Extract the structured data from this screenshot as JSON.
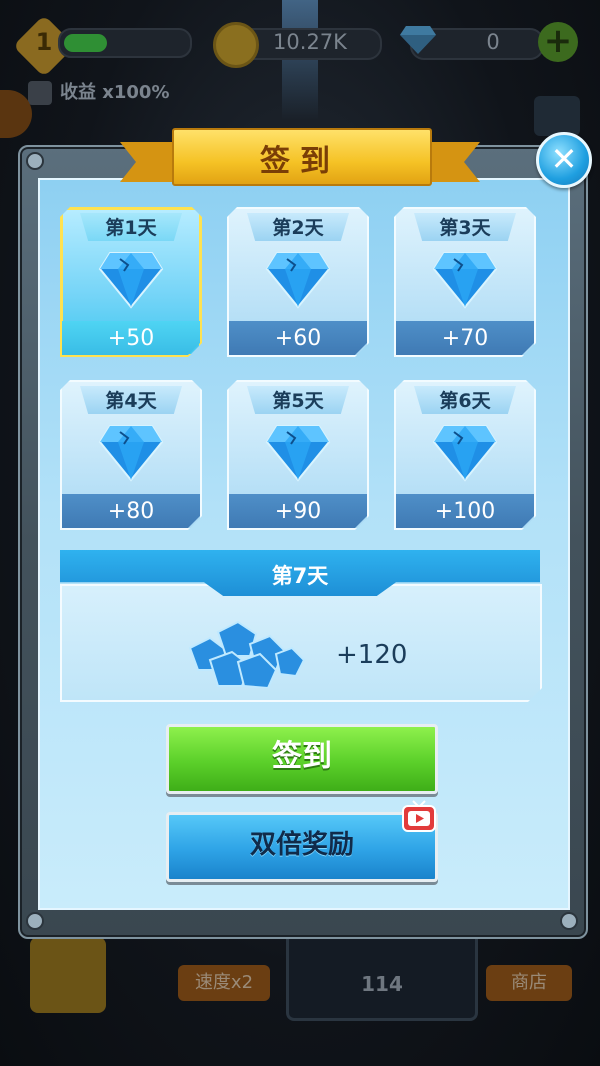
{
  "hud": {
    "level": "1",
    "level_progress": 0.35,
    "coins": "10.27K",
    "gems": "0",
    "plus_label": "+",
    "income": "收益 x100%"
  },
  "bottom_bar": {
    "speed_label": "速度x2",
    "slot_value": "114",
    "shop_label": "商店"
  },
  "modal": {
    "title": "签到",
    "close_label": "✕",
    "days": [
      {
        "label": "第1天",
        "reward": "+50",
        "active": true
      },
      {
        "label": "第2天",
        "reward": "+60",
        "active": false
      },
      {
        "label": "第3天",
        "reward": "+70",
        "active": false
      },
      {
        "label": "第4天",
        "reward": "+80",
        "active": false
      },
      {
        "label": "第5天",
        "reward": "+90",
        "active": false
      },
      {
        "label": "第6天",
        "reward": "+100",
        "active": false
      }
    ],
    "day7": {
      "label": "第7天",
      "reward": "+120"
    },
    "sign_button": "签到",
    "double_button": "双倍奖励"
  },
  "colors": {
    "active_border": "#ffe250",
    "sign_button": "#5bd02a",
    "double_button": "#2ea3e6",
    "title_ribbon": "#f5c225"
  },
  "icons": [
    "level-badge-icon",
    "coin-icon",
    "diamond-icon",
    "plus-icon",
    "income-arrow-icon",
    "close-icon",
    "video-tv-icon",
    "gem-pile-icon"
  ]
}
